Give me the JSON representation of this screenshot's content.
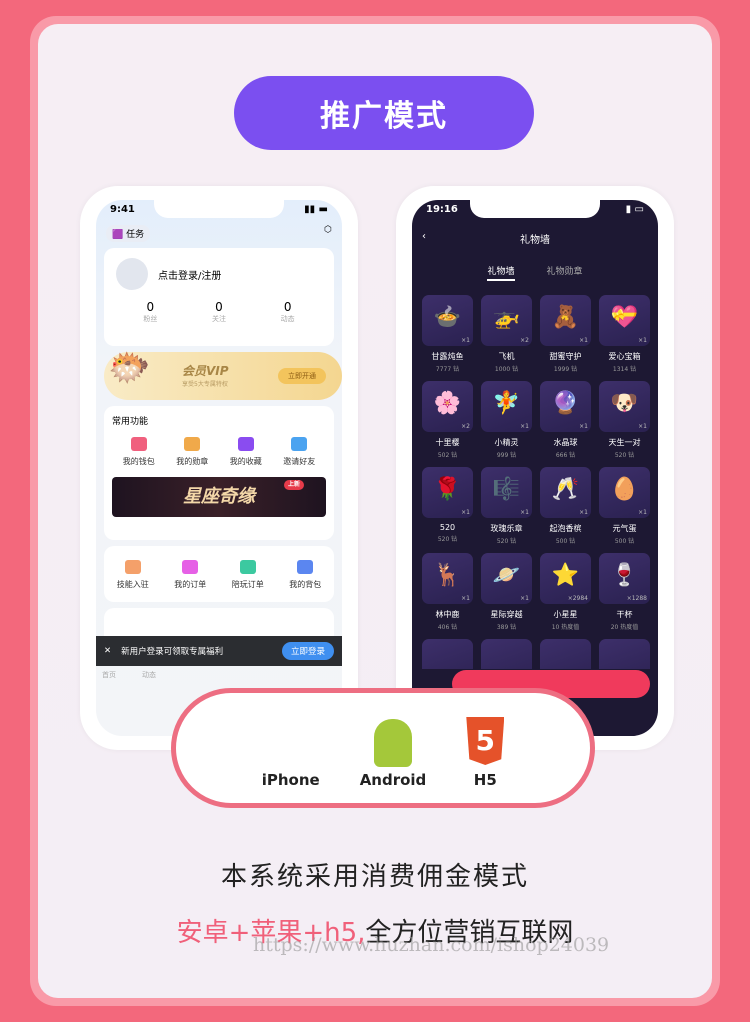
{
  "title": "推广模式",
  "left_phone": {
    "time": "9:41",
    "task": "任务",
    "login": "点击登录/注册",
    "stats": [
      {
        "v": "0",
        "l": "粉丝"
      },
      {
        "v": "0",
        "l": "关注"
      },
      {
        "v": "0",
        "l": "动态"
      }
    ],
    "vip": {
      "title": "会员VIP",
      "sub": "享受5大专属特权",
      "btn": "立即开通"
    },
    "section": "常用功能",
    "funcs": [
      {
        "l": "我的钱包",
        "c": "#f0607e"
      },
      {
        "l": "我的勋章",
        "c": "#f0a94a"
      },
      {
        "l": "我的收藏",
        "c": "#8a4cf0"
      },
      {
        "l": "邀请好友",
        "c": "#4ba3f0"
      }
    ],
    "banner": "星座奇缘",
    "banner_tag": "上新",
    "funcs2": [
      {
        "l": "技能入驻",
        "c": "#f4a06a"
      },
      {
        "l": "我的订单",
        "c": "#e660e6"
      },
      {
        "l": "陪玩订单",
        "c": "#3cc9a0"
      },
      {
        "l": "我的背包",
        "c": "#5b86f0"
      }
    ],
    "toast": "新用户登录可领取专属福利",
    "toast_btn": "立即登录",
    "tabs": [
      "首页",
      "动态"
    ]
  },
  "right_phone": {
    "time": "19:16",
    "title": "礼物墙",
    "tabs": [
      "礼物墙",
      "礼物勋章"
    ],
    "gifts": [
      {
        "n": "甘露炖鱼",
        "p": "7777 钻",
        "c": "×1",
        "e": "🍲"
      },
      {
        "n": "飞机",
        "p": "1000 钻",
        "c": "×2",
        "e": "🚁"
      },
      {
        "n": "甜蜜守护",
        "p": "1999 钻",
        "c": "×1",
        "e": "🧸"
      },
      {
        "n": "爱心宝箱",
        "p": "1314 钻",
        "c": "×1",
        "e": "💝"
      },
      {
        "n": "十里樱",
        "p": "502 钻",
        "c": "×2",
        "e": "🌸"
      },
      {
        "n": "小精灵",
        "p": "999 钻",
        "c": "×1",
        "e": "🧚"
      },
      {
        "n": "水晶球",
        "p": "666 钻",
        "c": "×1",
        "e": "🔮"
      },
      {
        "n": "天生一对",
        "p": "520 钻",
        "c": "×1",
        "e": "🐶"
      },
      {
        "n": "520",
        "p": "520 钻",
        "c": "×1",
        "e": "🌹"
      },
      {
        "n": "玫瑰乐章",
        "p": "520 钻",
        "c": "×1",
        "e": "🎼"
      },
      {
        "n": "起泡香槟",
        "p": "500 钻",
        "c": "×1",
        "e": "🥂"
      },
      {
        "n": "元气蛋",
        "p": "500 钻",
        "c": "×1",
        "e": "🥚"
      },
      {
        "n": "林中鹿",
        "p": "406 钻",
        "c": "×1",
        "e": "🦌"
      },
      {
        "n": "星际穿越",
        "p": "389 钻",
        "c": "×1",
        "e": "🪐"
      },
      {
        "n": "小星星",
        "p": "10 热度值",
        "c": "×2984",
        "e": "⭐"
      },
      {
        "n": "干杯",
        "p": "20 热度值",
        "c": "×1288",
        "e": "🍷"
      }
    ]
  },
  "platforms": [
    {
      "name": "iPhone",
      "icon": "apple-icon"
    },
    {
      "name": "Android",
      "icon": "android-icon"
    },
    {
      "name": "H5",
      "icon": "html5-icon"
    }
  ],
  "line1": "本系统采用消费佣金模式",
  "line2_red": "安卓+苹果+h5,",
  "line2": "全方位营销互联网",
  "watermark": "https://www.huzhan.com/ishop24039"
}
